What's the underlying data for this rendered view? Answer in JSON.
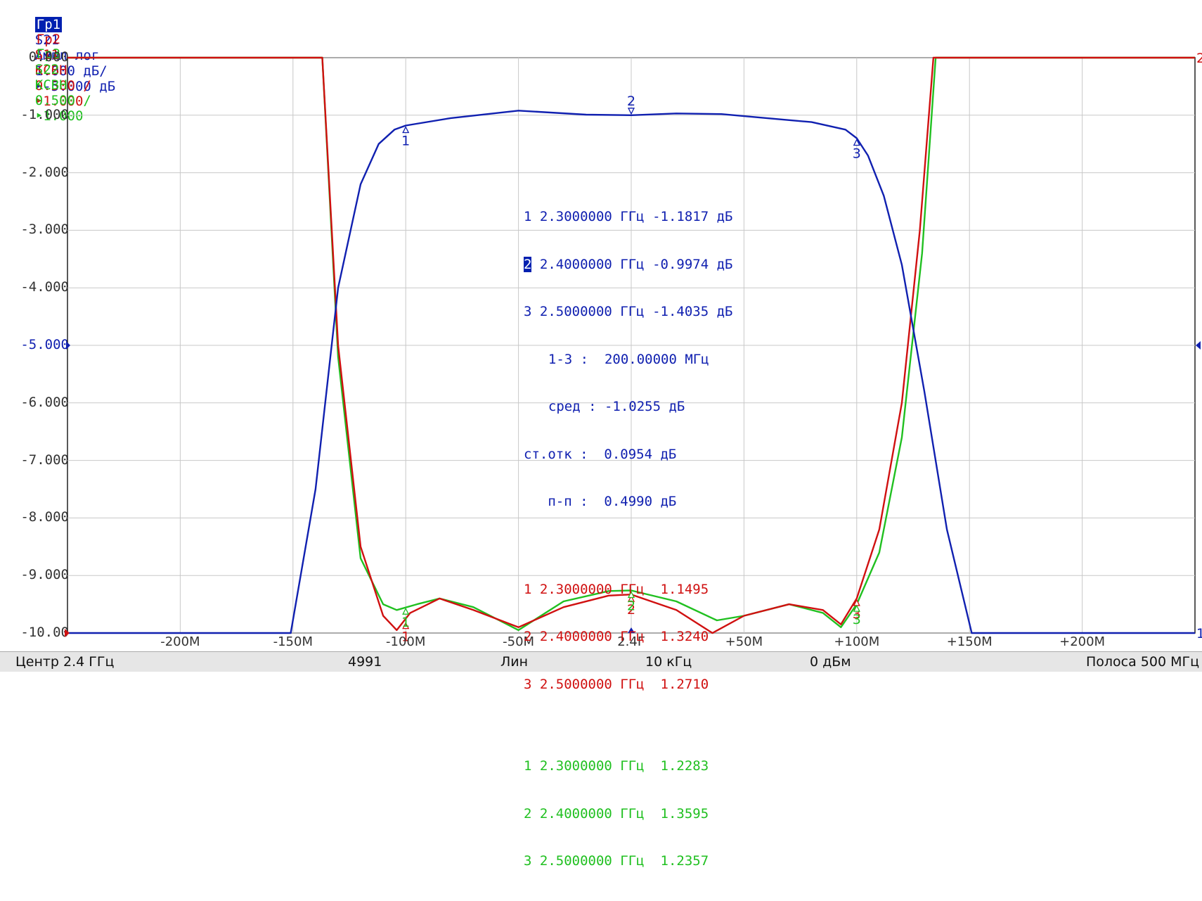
{
  "colors": {
    "s21": "#1020b0",
    "s11": "#d01010",
    "s22": "#20c020",
    "grid": "#c8c8c8",
    "axis": "#202020"
  },
  "traces": [
    {
      "tag": "Гр1",
      "param": "S21",
      "format": "Ампл лог",
      "scale": "1.000 дБ/",
      "ref": "-5.000 дБ",
      "active": true
    },
    {
      "tag": "Гр2",
      "param": "S11",
      "format": "КСВН",
      "scale": "0.500 /",
      "ref": "1.000",
      "active": false
    },
    {
      "tag": "Гр3",
      "param": "S22",
      "format": "КСВН",
      "scale": "0.500 /",
      "ref": "1.000",
      "active": false
    }
  ],
  "chart_data": {
    "type": "line",
    "xlim": [
      -250,
      250
    ],
    "ylim": [
      -10,
      0
    ],
    "x_unit": "MHz offset from center 2.4 GHz",
    "y_ticks": [
      "0.000",
      "-1.000",
      "-2.000",
      "-3.000",
      "-4.000",
      "-5.000",
      "-6.000",
      "-7.000",
      "-8.000",
      "-9.000",
      "-10.00"
    ],
    "x_ticks": [
      {
        "v": -200,
        "label": "-200M"
      },
      {
        "v": -150,
        "label": "-150M"
      },
      {
        "v": -100,
        "label": "-100M"
      },
      {
        "v": -50,
        "label": "-50M"
      },
      {
        "v": 0,
        "label": "2.4Г"
      },
      {
        "v": 50,
        "label": "+50M"
      },
      {
        "v": 100,
        "label": "+100M"
      },
      {
        "v": 150,
        "label": "+150M"
      },
      {
        "v": 200,
        "label": "+200M"
      }
    ],
    "grid": true,
    "series": [
      {
        "name": "S21",
        "color": "#1020b0",
        "x": [
          -250,
          -151,
          -140,
          -130,
          -120,
          -112,
          -105,
          -100,
          -80,
          -50,
          -20,
          0,
          20,
          40,
          60,
          80,
          95,
          100,
          105,
          112,
          120,
          130,
          140,
          151,
          250
        ],
        "y": [
          -10,
          -10,
          -7.5,
          -4.0,
          -2.2,
          -1.5,
          -1.25,
          -1.18,
          -1.05,
          -0.92,
          -0.99,
          -1.0,
          -0.97,
          -0.98,
          -1.05,
          -1.12,
          -1.25,
          -1.4,
          -1.7,
          -2.4,
          -3.6,
          -5.8,
          -8.2,
          -10,
          -10
        ]
      },
      {
        "name": "S11",
        "color": "#d01010",
        "x": [
          -250,
          -137,
          -130,
          -120,
          -110,
          -104,
          -98,
          -85,
          -70,
          -50,
          -30,
          -10,
          0,
          20,
          36,
          50,
          70,
          85,
          93,
          100,
          110,
          120,
          128,
          134,
          250
        ],
        "y": [
          0,
          0,
          -5.0,
          -8.5,
          -9.7,
          -9.95,
          -9.65,
          -9.4,
          -9.6,
          -9.9,
          -9.55,
          -9.35,
          -9.33,
          -9.6,
          -10.0,
          -9.7,
          -9.5,
          -9.6,
          -9.85,
          -9.4,
          -8.2,
          -6.0,
          -3.0,
          0,
          0
        ]
      },
      {
        "name": "S22",
        "color": "#20c020",
        "x": [
          -250,
          -137,
          -130,
          -120,
          -110,
          -104,
          -95,
          -85,
          -70,
          -50,
          -30,
          -10,
          0,
          20,
          38,
          50,
          70,
          85,
          93,
          100,
          110,
          120,
          129,
          135,
          250
        ],
        "y": [
          0,
          0,
          -5.2,
          -8.7,
          -9.5,
          -9.6,
          -9.5,
          -9.4,
          -9.55,
          -9.95,
          -9.45,
          -9.27,
          -9.26,
          -9.45,
          -9.78,
          -9.7,
          -9.5,
          -9.65,
          -9.9,
          -9.5,
          -8.6,
          -6.6,
          -3.4,
          0,
          0
        ]
      }
    ]
  },
  "markers": {
    "s21": [
      {
        "n": "1",
        "x": -100,
        "y": -1.18
      },
      {
        "n": "2",
        "x": 0,
        "y": -1.0
      },
      {
        "n": "3",
        "x": 100,
        "y": -1.4
      }
    ],
    "s11": [
      {
        "n": "1",
        "x": -100,
        "y": -9.8
      },
      {
        "n": "2",
        "x": 0,
        "y": -9.33
      },
      {
        "n": "3",
        "x": 100,
        "y": -9.4
      }
    ],
    "s22": [
      {
        "n": "1",
        "x": -100,
        "y": -9.55
      },
      {
        "n": "2",
        "x": 0,
        "y": -9.26
      },
      {
        "n": "3",
        "x": 100,
        "y": -9.5
      }
    ]
  },
  "ref_marker": {
    "y": -5,
    "right_s21": "◄",
    "left_s21": "►",
    "right_s11": "2",
    "right_s22": "1"
  },
  "readout": {
    "s21": [
      {
        "n": "1",
        "freq": "2.3000000 ГГц",
        "val": "-1.1817 дБ",
        "sel": false
      },
      {
        "n": "2",
        "freq": "2.4000000 ГГц",
        "val": "-0.9974 дБ",
        "sel": true
      },
      {
        "n": "3",
        "freq": "2.5000000 ГГц",
        "val": "-1.4035 дБ",
        "sel": false
      }
    ],
    "stats": [
      "  1-3 :  200.00000 МГц",
      "  сред : -1.0255 дБ",
      "ст.отк :  0.0954 дБ",
      "   п-п :  0.4990 дБ"
    ],
    "s11": [
      {
        "n": "1",
        "freq": "2.3000000 ГГц",
        "val": "1.1495"
      },
      {
        "n": "2",
        "freq": "2.4000000 ГГц",
        "val": "1.3240"
      },
      {
        "n": "3",
        "freq": "2.5000000 ГГц",
        "val": "1.2710"
      }
    ],
    "s22": [
      {
        "n": "1",
        "freq": "2.3000000 ГГц",
        "val": "1.2283"
      },
      {
        "n": "2",
        "freq": "2.4000000 ГГц",
        "val": "1.3595"
      },
      {
        "n": "3",
        "freq": "2.5000000 ГГц",
        "val": "1.2357"
      }
    ]
  },
  "status": {
    "center": "Центр 2.4 ГГц",
    "points": "4991",
    "sweep": "Лин",
    "ifbw": "10 кГц",
    "power": "0 дБм",
    "span": "Полоса 500 МГц"
  }
}
